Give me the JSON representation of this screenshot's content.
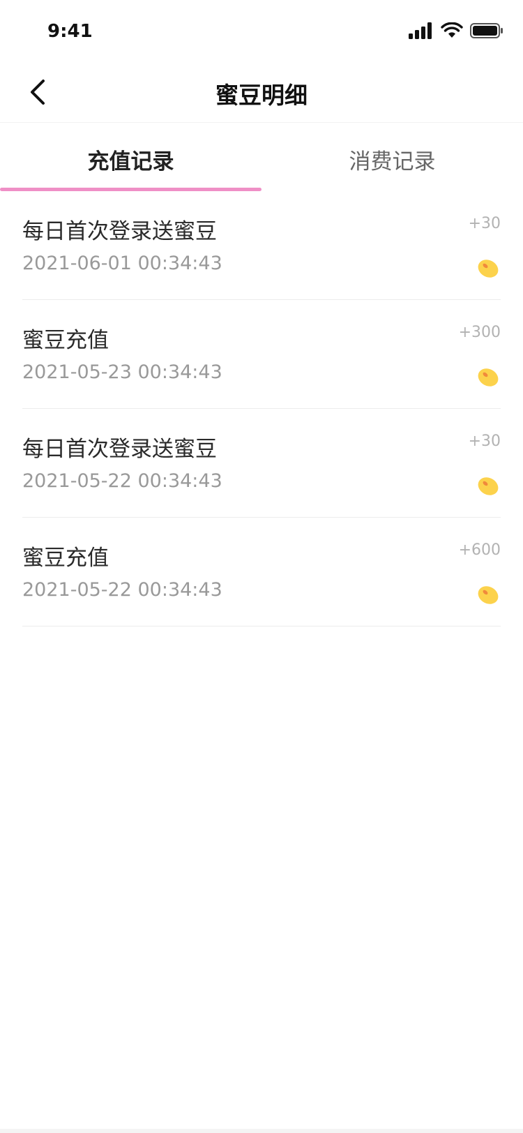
{
  "status_bar": {
    "time": "9:41",
    "icons": [
      "signal-icon",
      "wifi-icon",
      "battery-icon"
    ]
  },
  "nav": {
    "title": "蜜豆明细",
    "back_icon": "chevron-left-icon"
  },
  "tabs": [
    {
      "label": "充值记录",
      "active": true
    },
    {
      "label": "消费记录",
      "active": false
    }
  ],
  "accent_color": "#ef8fc6",
  "records": [
    {
      "title": "每日首次登录送蜜豆",
      "time": "2021-06-01 00:34:43",
      "amount": "+30",
      "icon": "bean-icon"
    },
    {
      "title": "蜜豆充值",
      "time": "2021-05-23 00:34:43",
      "amount": "+300",
      "icon": "bean-icon"
    },
    {
      "title": "每日首次登录送蜜豆",
      "time": "2021-05-22 00:34:43",
      "amount": "+30",
      "icon": "bean-icon"
    },
    {
      "title": "蜜豆充值",
      "time": "2021-05-22 00:34:43",
      "amount": "+600",
      "icon": "bean-icon"
    }
  ]
}
